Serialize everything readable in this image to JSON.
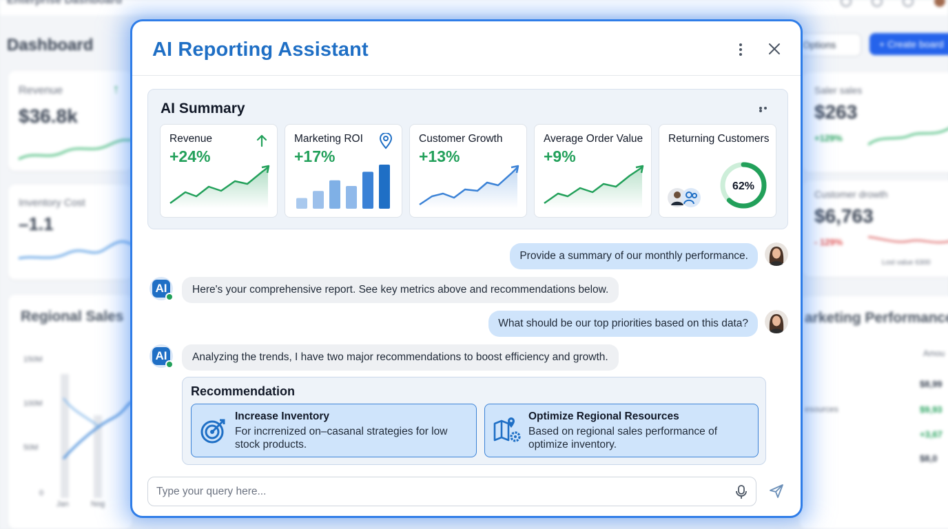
{
  "background": {
    "app_title": "Enterprise Dashboard",
    "page_title": "Dashboard",
    "options_label": "Options",
    "create_label": "+ Create board",
    "revenue": {
      "label": "Revenue",
      "value": "$36.8k"
    },
    "inventory_cost": {
      "label": "Inventory Cost",
      "value": "–1.1"
    },
    "regional_sales": {
      "title": "Regional Sales",
      "ticks": [
        "150M",
        "100M",
        "50M",
        "0"
      ],
      "months": [
        "Jan",
        "Nog"
      ]
    },
    "sales": {
      "label": "Saler sales",
      "value": "$263",
      "change": "+129%"
    },
    "customer_growth": {
      "label": "Customer drowth",
      "value": "$6,763",
      "change": "- 129%",
      "note": "Lost value 6300"
    },
    "marketing_performance": {
      "title": "arketing Performance",
      "col": "Amou",
      "rows": [
        {
          "label": "",
          "value": "$8,99"
        },
        {
          "label": "esources",
          "value": "$9,93"
        },
        {
          "label": "",
          "value": "+3,67"
        },
        {
          "label": "",
          "value": "$8,0"
        }
      ]
    }
  },
  "modal": {
    "title": "AI Reporting Assistant",
    "summary": {
      "title": "AI Summary",
      "metrics": [
        {
          "label": "Revenue",
          "value": "+24%",
          "icon": "arrow-up-icon"
        },
        {
          "label": "Marketing ROI",
          "value": "+17%",
          "icon": "location-pin-icon",
          "bars": [
            15,
            25,
            40,
            32,
            52,
            62
          ]
        },
        {
          "label": "Customer Growth",
          "value": "+13%"
        },
        {
          "label": "Average Order Value",
          "value": "+9%"
        },
        {
          "label": "Returning Customers",
          "value": "",
          "ring_percent": "62%",
          "ring_fraction": 0.62
        }
      ]
    },
    "messages": [
      {
        "from": "user",
        "text": "Provide a summary of our monthly performance."
      },
      {
        "from": "ai",
        "text": "Here's your comprehensive report. See key metrics above and recommendations below."
      },
      {
        "from": "user",
        "text": "What should be our top priorities based on this data?"
      },
      {
        "from": "ai",
        "text": "Analyzing the trends, I have two major recommendations to boost efficiency and growth."
      }
    ],
    "ai_badge": "AI",
    "recommendation": {
      "title": "Recommendation",
      "items": [
        {
          "title": "Increase Inventory",
          "desc": "For incrrenized on–casanal strategies for low stock products.",
          "icon": "target-icon"
        },
        {
          "title": "Optimize Regional Resources",
          "desc": "Based on regional sales performance of optimize inventory.",
          "icon": "map-gear-icon"
        }
      ]
    },
    "input_placeholder": "Type your query here..."
  },
  "colors": {
    "accent": "#1f6fc5",
    "positive": "#22a05a",
    "border": "#2f7de8"
  }
}
